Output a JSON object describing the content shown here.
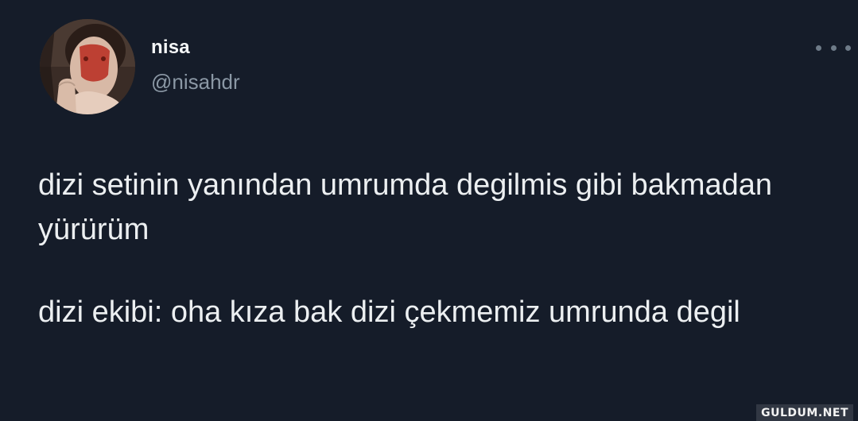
{
  "tweet": {
    "author": {
      "display_name": "nisa",
      "handle": "@nisahdr",
      "avatar_icon": "profile-photo"
    },
    "more_icon": "ellipsis-icon",
    "paragraphs": [
      "dizi setinin yanından umrumda degilmis gibi bakmadan yürürüm",
      "dizi ekibi: oha kıza bak dizi çekmemiz umrunda degil"
    ]
  },
  "watermark": "GULDUM.NET",
  "colors": {
    "background": "#151c29",
    "text": "#e7e9ea",
    "handle": "#8b98a5"
  }
}
